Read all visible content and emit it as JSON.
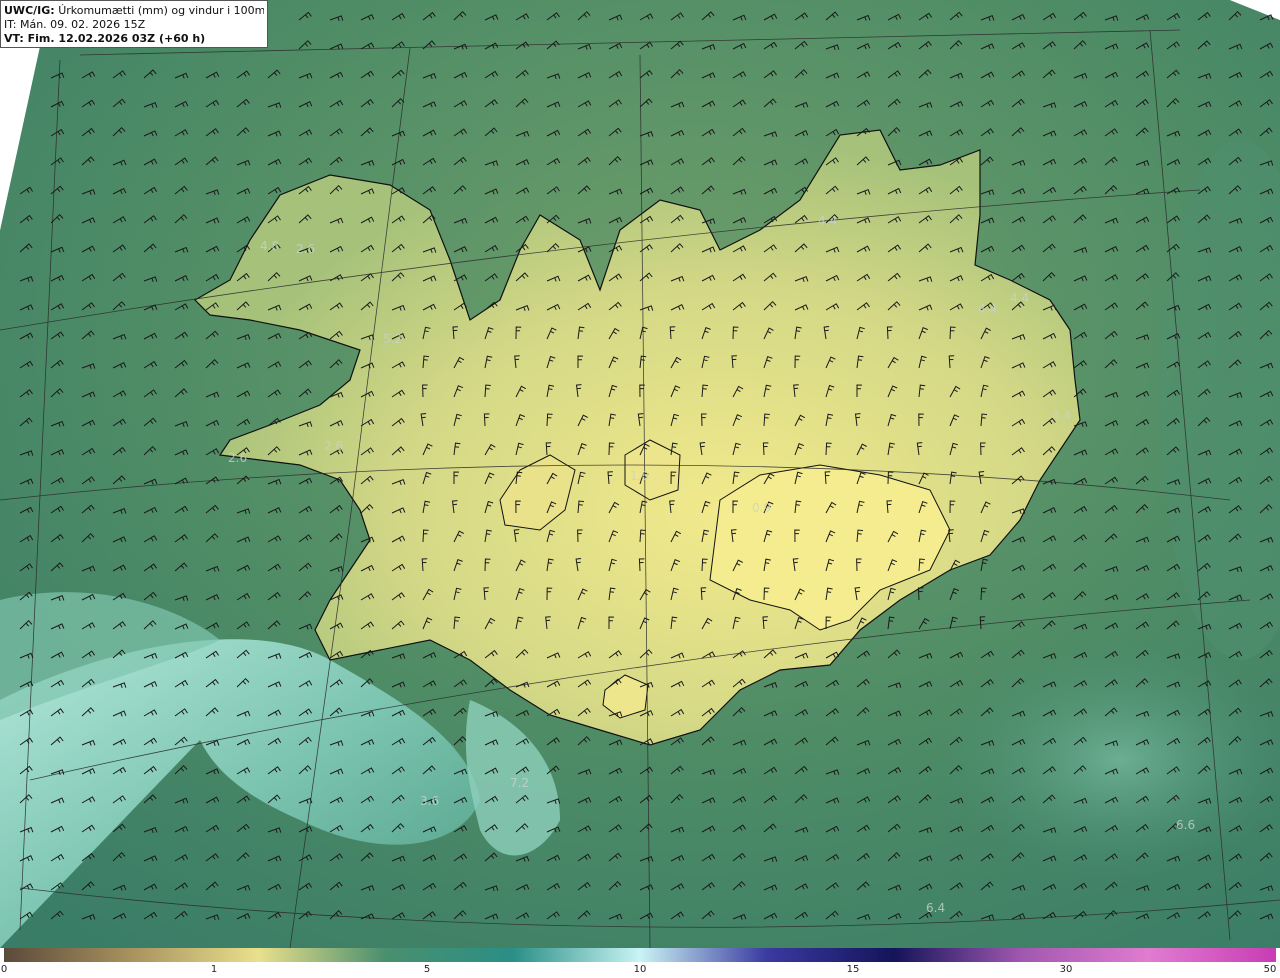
{
  "header": {
    "model_prefix": "UWC/IG:",
    "title": "Úrkomumætti (mm) og vindur i 100m hæð",
    "initial_time": "IT: Mán. 09. 02. 2026 15Z",
    "valid_prefix": "VT: Fim.",
    "valid_time": "12.02.2026 03Z (+60 h)"
  },
  "colorbar": {
    "ticks": [
      "0",
      "1",
      "5",
      "10",
      "15",
      "30",
      "50"
    ],
    "colors": [
      "#5b4a3a",
      "#a8925e",
      "#e9e08c",
      "#4a8f6e",
      "#2a8f86",
      "#c9f4f4",
      "#3a3aa0",
      "#14145a",
      "#a058b0",
      "#e07cd0",
      "#c83cb4"
    ]
  },
  "map": {
    "colors": {
      "land_dry": "#f0e78a",
      "land_mid": "#b8cc7e",
      "sea_green": "#3f8a66",
      "sea_teal": "#5fb0a0",
      "sea_light": "#a8e6d6",
      "outline": "#111111",
      "barb": "#1a1a1a"
    },
    "labels": [
      "4.8",
      "2.6",
      "5.2",
      "2.6",
      "2.6",
      "4.4",
      "4.4",
      "4.4",
      "4.4",
      "1.0",
      "0.9",
      "7.2",
      "3.6",
      "6.6",
      "6.4"
    ]
  }
}
